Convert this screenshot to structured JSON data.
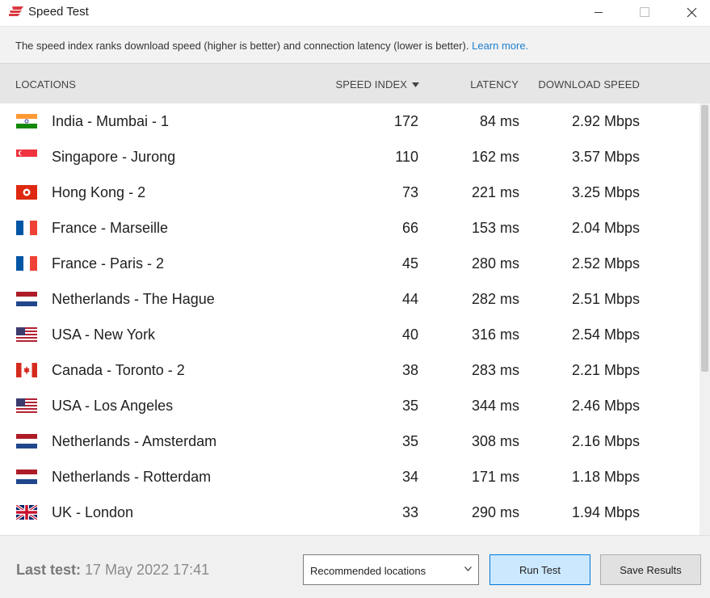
{
  "window": {
    "title": "Speed Test"
  },
  "info": {
    "text": "The speed index ranks download speed (higher is better) and connection latency (lower is better).",
    "link": "Learn more."
  },
  "columns": {
    "locations": "LOCATIONS",
    "speed_index": "SPEED INDEX",
    "latency": "LATENCY",
    "download": "DOWNLOAD SPEED"
  },
  "rows": [
    {
      "flag": "india-flag-icon",
      "location": "India - Mumbai - 1",
      "speed_index": "172",
      "latency": "84 ms",
      "download": "2.92 Mbps"
    },
    {
      "flag": "singapore-flag-icon",
      "location": "Singapore - Jurong",
      "speed_index": "110",
      "latency": "162 ms",
      "download": "3.57 Mbps"
    },
    {
      "flag": "hong-kong-flag-icon",
      "location": "Hong Kong - 2",
      "speed_index": "73",
      "latency": "221 ms",
      "download": "3.25 Mbps"
    },
    {
      "flag": "france-flag-icon",
      "location": "France - Marseille",
      "speed_index": "66",
      "latency": "153 ms",
      "download": "2.04 Mbps"
    },
    {
      "flag": "france-flag-icon",
      "location": "France - Paris - 2",
      "speed_index": "45",
      "latency": "280 ms",
      "download": "2.52 Mbps"
    },
    {
      "flag": "netherlands-flag-icon",
      "location": "Netherlands - The Hague",
      "speed_index": "44",
      "latency": "282 ms",
      "download": "2.51 Mbps"
    },
    {
      "flag": "usa-flag-icon",
      "location": "USA - New York",
      "speed_index": "40",
      "latency": "316 ms",
      "download": "2.54 Mbps"
    },
    {
      "flag": "canada-flag-icon",
      "location": "Canada - Toronto - 2",
      "speed_index": "38",
      "latency": "283 ms",
      "download": "2.21 Mbps"
    },
    {
      "flag": "usa-flag-icon",
      "location": "USA - Los Angeles",
      "speed_index": "35",
      "latency": "344 ms",
      "download": "2.46 Mbps"
    },
    {
      "flag": "netherlands-flag-icon",
      "location": "Netherlands - Amsterdam",
      "speed_index": "35",
      "latency": "308 ms",
      "download": "2.16 Mbps"
    },
    {
      "flag": "netherlands-flag-icon",
      "location": "Netherlands - Rotterdam",
      "speed_index": "34",
      "latency": "171 ms",
      "download": "1.18 Mbps"
    },
    {
      "flag": "uk-flag-icon",
      "location": "UK - London",
      "speed_index": "33",
      "latency": "290 ms",
      "download": "1.94 Mbps"
    }
  ],
  "footer": {
    "last_label": "Last test:",
    "last_value": "17 May 2022 17:41",
    "select_value": "Recommended locations",
    "run_label": "Run Test",
    "save_label": "Save Results"
  },
  "colors": {
    "brand": "#da3940",
    "accent": "#0078d7",
    "link": "#1e7fd0"
  }
}
